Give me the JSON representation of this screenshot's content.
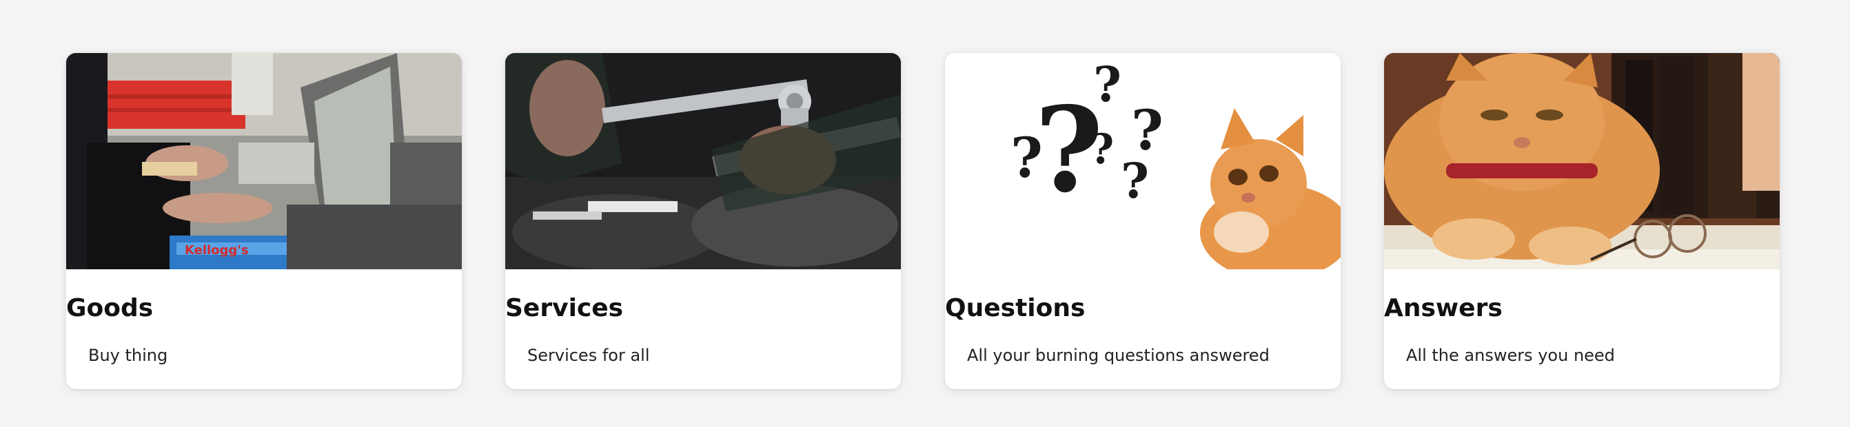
{
  "cards": [
    {
      "title": "Goods",
      "description": "Buy thing",
      "image": "checkout-counter-photo"
    },
    {
      "title": "Services",
      "description": "Services for all",
      "image": "mechanic-engine-photo"
    },
    {
      "title": "Questions",
      "description": "All your burning questions answered",
      "image": "cat-question-marks-photo"
    },
    {
      "title": "Answers",
      "description": "All the answers you need",
      "image": "smug-cat-glasses-photo"
    }
  ]
}
